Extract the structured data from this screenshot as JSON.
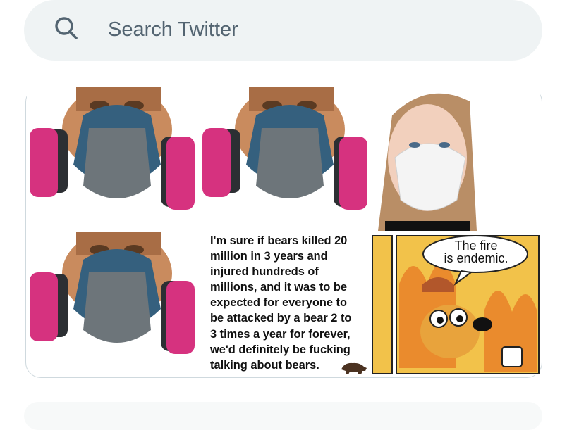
{
  "search": {
    "placeholder": "Search Twitter",
    "icon": "search-icon"
  },
  "media": {
    "meme_text": "I'm sure if bears killed 20\nmillion in 3 years and\ninjured hundreds of\nmillions, and it was to be\nexpected for everyone to\nbe attacked by a bear 2 to\n3 times a year for forever,\nwe'd definitely be fucking\ntalking about bears.",
    "speech_bubble": "The fire\nis endemic."
  },
  "colors": {
    "search_bg": "#eff3f4",
    "placeholder": "#536471",
    "border": "#cfd9de",
    "filter_pink": "#d6327f",
    "mask_blue": "#35607e",
    "fire_yellow": "#f2c24a"
  }
}
